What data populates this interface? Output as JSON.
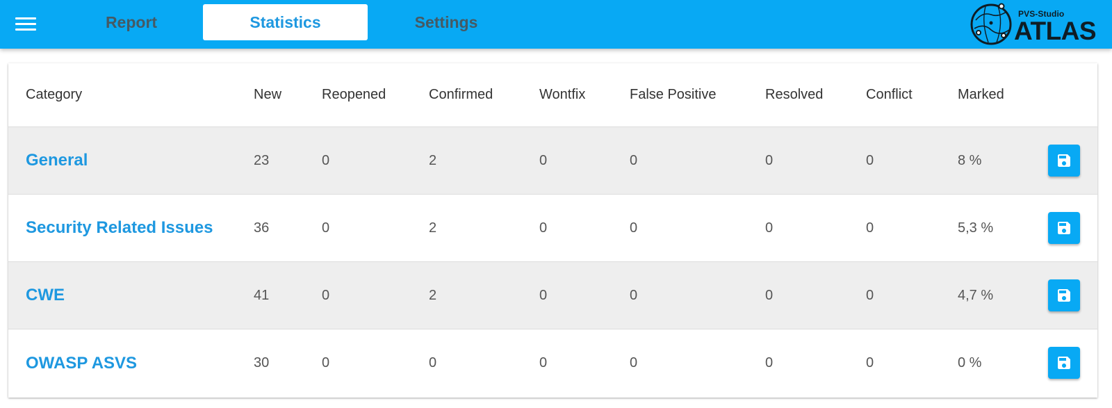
{
  "nav": {
    "tabs": [
      {
        "label": "Report"
      },
      {
        "label": "Statistics"
      },
      {
        "label": "Settings"
      }
    ],
    "active_tab": "Statistics"
  },
  "logo": {
    "small_text": "PVS-Studio",
    "big_text": "ATLAS"
  },
  "table": {
    "headers": [
      "Category",
      "New",
      "Reopened",
      "Confirmed",
      "Wontfix",
      "False Positive",
      "Resolved",
      "Conflict",
      "Marked"
    ],
    "rows": [
      {
        "category": "General",
        "new": "23",
        "reopened": "0",
        "confirmed": "2",
        "wontfix": "0",
        "false_positive": "0",
        "resolved": "0",
        "conflict": "0",
        "marked": "8 %"
      },
      {
        "category": "Security Related Issues",
        "new": "36",
        "reopened": "0",
        "confirmed": "2",
        "wontfix": "0",
        "false_positive": "0",
        "resolved": "0",
        "conflict": "0",
        "marked": "5,3 %"
      },
      {
        "category": "CWE",
        "new": "41",
        "reopened": "0",
        "confirmed": "2",
        "wontfix": "0",
        "false_positive": "0",
        "resolved": "0",
        "conflict": "0",
        "marked": "4,7 %"
      },
      {
        "category": "OWASP ASVS",
        "new": "30",
        "reopened": "0",
        "confirmed": "0",
        "wontfix": "0",
        "false_positive": "0",
        "resolved": "0",
        "conflict": "0",
        "marked": "0 %"
      }
    ]
  },
  "icons": {
    "menu": "hamburger-menu-icon",
    "save": "floppy-disk-icon"
  },
  "colors": {
    "accent": "#08a9f4",
    "link": "#1e98e0",
    "row_stripe": "#eeeeee"
  }
}
